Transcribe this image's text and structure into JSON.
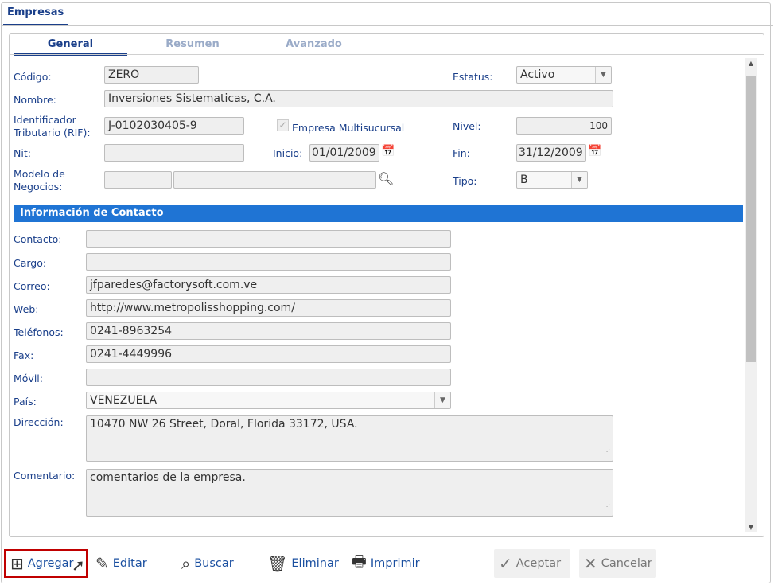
{
  "window_tab": "Empresas",
  "tabs": [
    "General",
    "Resumen",
    "Avanzado"
  ],
  "form": {
    "codigo": {
      "label": "Código:",
      "value": "ZERO"
    },
    "estatus": {
      "label": "Estatus:",
      "value": "Activo"
    },
    "nombre": {
      "label": "Nombre:",
      "value": "Inversiones Sistematicas, C.A."
    },
    "rif": {
      "label": "Identificador Tributario (RIF):",
      "value": "J-0102030405-9"
    },
    "multisucursal": {
      "label": "Empresa Multisucursal",
      "checked": true
    },
    "nivel": {
      "label": "Nivel:",
      "value": "100"
    },
    "nit": {
      "label": "Nit:",
      "value": ""
    },
    "inicio": {
      "label": "Inicio:",
      "value": "01/01/2009"
    },
    "fin": {
      "label": "Fin:",
      "value": "31/12/2009"
    },
    "modelo": {
      "label": "Modelo de Negocios:",
      "value1": "",
      "value2": ""
    },
    "tipo": {
      "label": "Tipo:",
      "value": "B"
    }
  },
  "contact_section": "Información de Contacto",
  "contact": {
    "contacto": {
      "label": "Contacto:",
      "value": ""
    },
    "cargo": {
      "label": "Cargo:",
      "value": ""
    },
    "correo": {
      "label": "Correo:",
      "value": "jfparedes@factorysoft.com.ve"
    },
    "web": {
      "label": "Web:",
      "value": "http://www.metropolisshopping.com/"
    },
    "telefonos": {
      "label": "Teléfonos:",
      "value": "0241-8963254"
    },
    "fax": {
      "label": "Fax:",
      "value": "0241-4449996"
    },
    "movil": {
      "label": "Móvil:",
      "value": ""
    },
    "pais": {
      "label": "País:",
      "value": "VENEZUELA"
    },
    "direccion": {
      "label": "Dirección:",
      "value": "10470 NW 26 Street, Doral, Florida 33172, USA."
    },
    "comentario": {
      "label": "Comentario:",
      "value": "comentarios de la empresa."
    }
  },
  "toolbar": {
    "agregar": "Agregar",
    "editar": "Editar",
    "buscar": "Buscar",
    "eliminar": "Eliminar",
    "imprimir": "Imprimir",
    "aceptar": "Aceptar",
    "cancelar": "Cancelar"
  },
  "colors": {
    "accent": "#1a3f8a",
    "section": "#1f74d4",
    "highlight": "#c00000"
  }
}
